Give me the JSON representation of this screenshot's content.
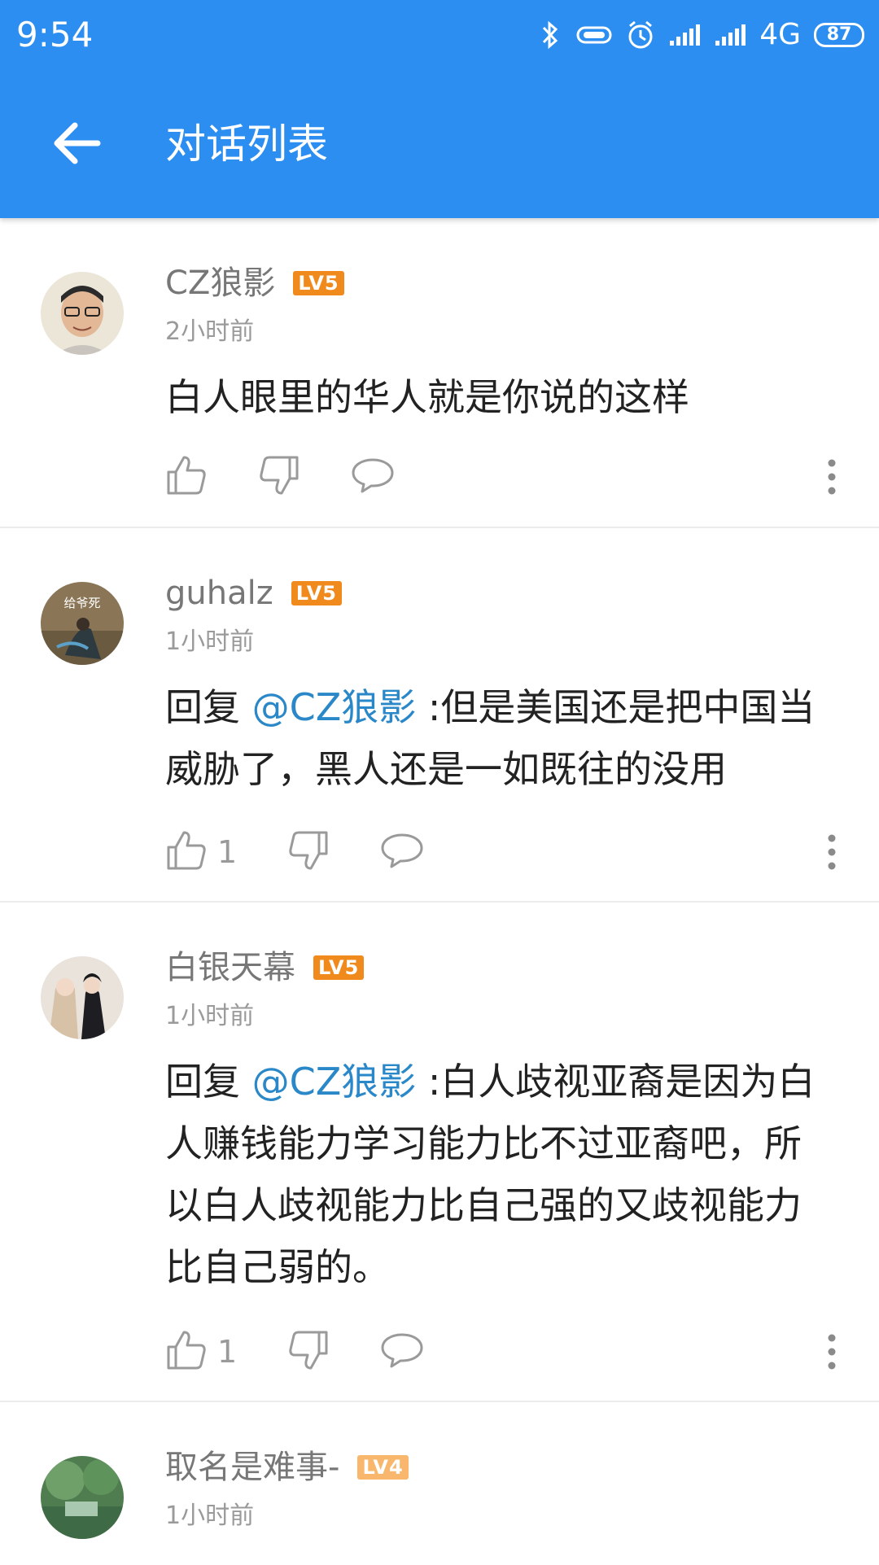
{
  "status_bar": {
    "time": "9:54",
    "network": "4G",
    "battery": "87",
    "icons": [
      "bluetooth-icon",
      "link-icon",
      "alarm-icon",
      "signal-icon",
      "signal-icon",
      "battery-icon"
    ]
  },
  "header": {
    "title": "对话列表",
    "back_icon": "back-arrow-icon"
  },
  "colors": {
    "header_bg": "#2c8ef0",
    "mention": "#2a88c9",
    "level_badge": "#f08a1c",
    "level_badge_light": "#f8b76c"
  },
  "comments": [
    {
      "username": "CZ狼影",
      "level": "LV5",
      "time": "2小时前",
      "text": "白人眼里的华人就是你说的这样",
      "likes": ""
    },
    {
      "username": "guhalz",
      "level": "LV5",
      "time": "1小时前",
      "reply_prefix": "回复 ",
      "mention": "@CZ狼影",
      "text": " :但是美国还是把中国当威胁了，黑人还是一如既往的没用",
      "likes": "1",
      "avatar_text": "给爷死"
    },
    {
      "username": "白银天幕",
      "level": "LV5",
      "time": "1小时前",
      "reply_prefix": "回复 ",
      "mention": "@CZ狼影",
      "text": " :白人歧视亚裔是因为白人赚钱能力学习能力比不过亚裔吧，所以白人歧视能力比自己强的又歧视能力比自己弱的。",
      "likes": "1"
    },
    {
      "username": "取名是难事-",
      "level": "LV4",
      "time": "1小时前"
    }
  ]
}
